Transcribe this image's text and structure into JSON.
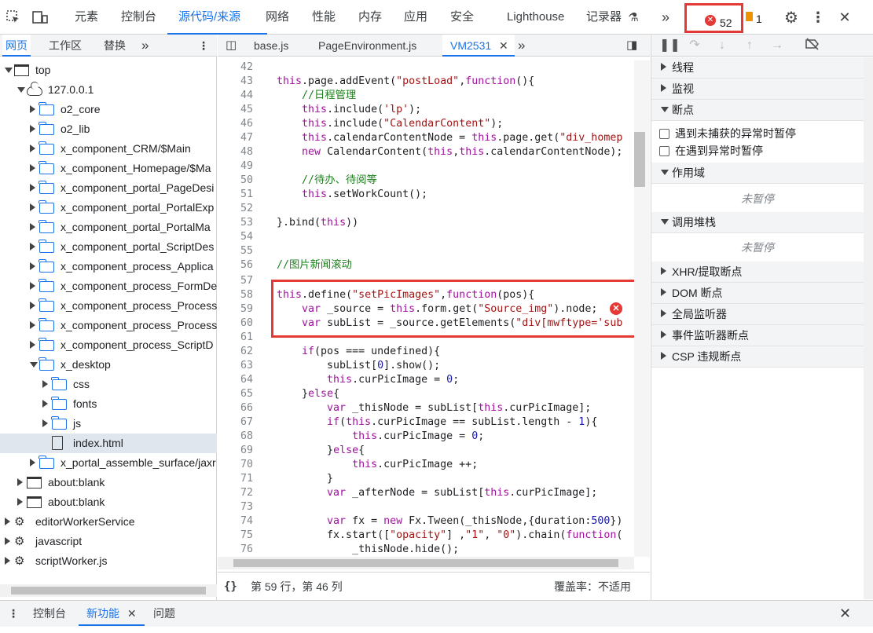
{
  "toolbar": {
    "tabs": [
      "元素",
      "控制台",
      "源代码/来源",
      "网络",
      "性能",
      "内存",
      "应用",
      "安全",
      "Lighthouse",
      "记录器"
    ],
    "more": "»",
    "errors": "52",
    "warnings": "1",
    "close": "✕"
  },
  "left": {
    "tabs": [
      "网页",
      "工作区",
      "替换"
    ],
    "more": "»",
    "menu": "⋮",
    "tree": [
      {
        "label": "top",
        "icon": "frame"
      },
      {
        "label": "127.0.0.1",
        "icon": "cloud"
      },
      {
        "label": "o2_core",
        "icon": "folder"
      },
      {
        "label": "o2_lib",
        "icon": "folder"
      },
      {
        "label": "x_component_CRM/$Main",
        "icon": "folder"
      },
      {
        "label": "x_component_Homepage/$Ma",
        "icon": "folder"
      },
      {
        "label": "x_component_portal_PageDesi",
        "icon": "folder"
      },
      {
        "label": "x_component_portal_PortalExp",
        "icon": "folder"
      },
      {
        "label": "x_component_portal_PortalMa",
        "icon": "folder"
      },
      {
        "label": "x_component_portal_ScriptDes",
        "icon": "folder"
      },
      {
        "label": "x_component_process_Applica",
        "icon": "folder"
      },
      {
        "label": "x_component_process_FormDe",
        "icon": "folder"
      },
      {
        "label": "x_component_process_Process",
        "icon": "folder"
      },
      {
        "label": "x_component_process_Process",
        "icon": "folder"
      },
      {
        "label": "x_component_process_ScriptD",
        "icon": "folder"
      },
      {
        "label": "x_desktop",
        "icon": "folder"
      },
      {
        "label": "css",
        "icon": "folder"
      },
      {
        "label": "fonts",
        "icon": "folder"
      },
      {
        "label": "js",
        "icon": "folder"
      },
      {
        "label": "index.html",
        "icon": "file"
      },
      {
        "label": "x_portal_assemble_surface/jaxr",
        "icon": "folder"
      },
      {
        "label": "about:blank",
        "icon": "frame"
      },
      {
        "label": "about:blank",
        "icon": "frame"
      },
      {
        "label": "editorWorkerService",
        "icon": "gear"
      },
      {
        "label": "javascript",
        "icon": "gear"
      },
      {
        "label": "scriptWorker.js",
        "icon": "gear"
      }
    ]
  },
  "editor": {
    "tabs": [
      "base.js",
      "PageEnvironment.js",
      "VM2531"
    ],
    "close": "✕",
    "more": "»",
    "lines": [
      "42",
      "43",
      "44",
      "45",
      "46",
      "47",
      "48",
      "49",
      "50",
      "51",
      "52",
      "53",
      "54",
      "55",
      "56",
      "57",
      "58",
      "59",
      "60",
      "61",
      "62",
      "63",
      "64",
      "65",
      "66",
      "67",
      "68",
      "69",
      "70",
      "71",
      "72",
      "73",
      "74",
      "75",
      "76"
    ],
    "status_pos": "第 59 行，第 46 列",
    "coverage": "覆盖率：不适用"
  },
  "debugger": {
    "sections": {
      "threads": "线程",
      "watch": "监视",
      "breakpoints": "断点",
      "scope": "作用域",
      "callstack": "调用堆栈",
      "xhr": "XHR/提取断点",
      "dom": "DOM 断点",
      "global": "全局监听器",
      "event": "事件监听器断点",
      "csp": "CSP 违规断点"
    },
    "checks": [
      "遇到未捕获的异常时暂停",
      "在遇到异常时暂停"
    ],
    "not_paused": "未暂停"
  },
  "drawer": {
    "menu": "⋮",
    "tabs": [
      "控制台",
      "新功能",
      "问题"
    ],
    "close": "✕"
  }
}
